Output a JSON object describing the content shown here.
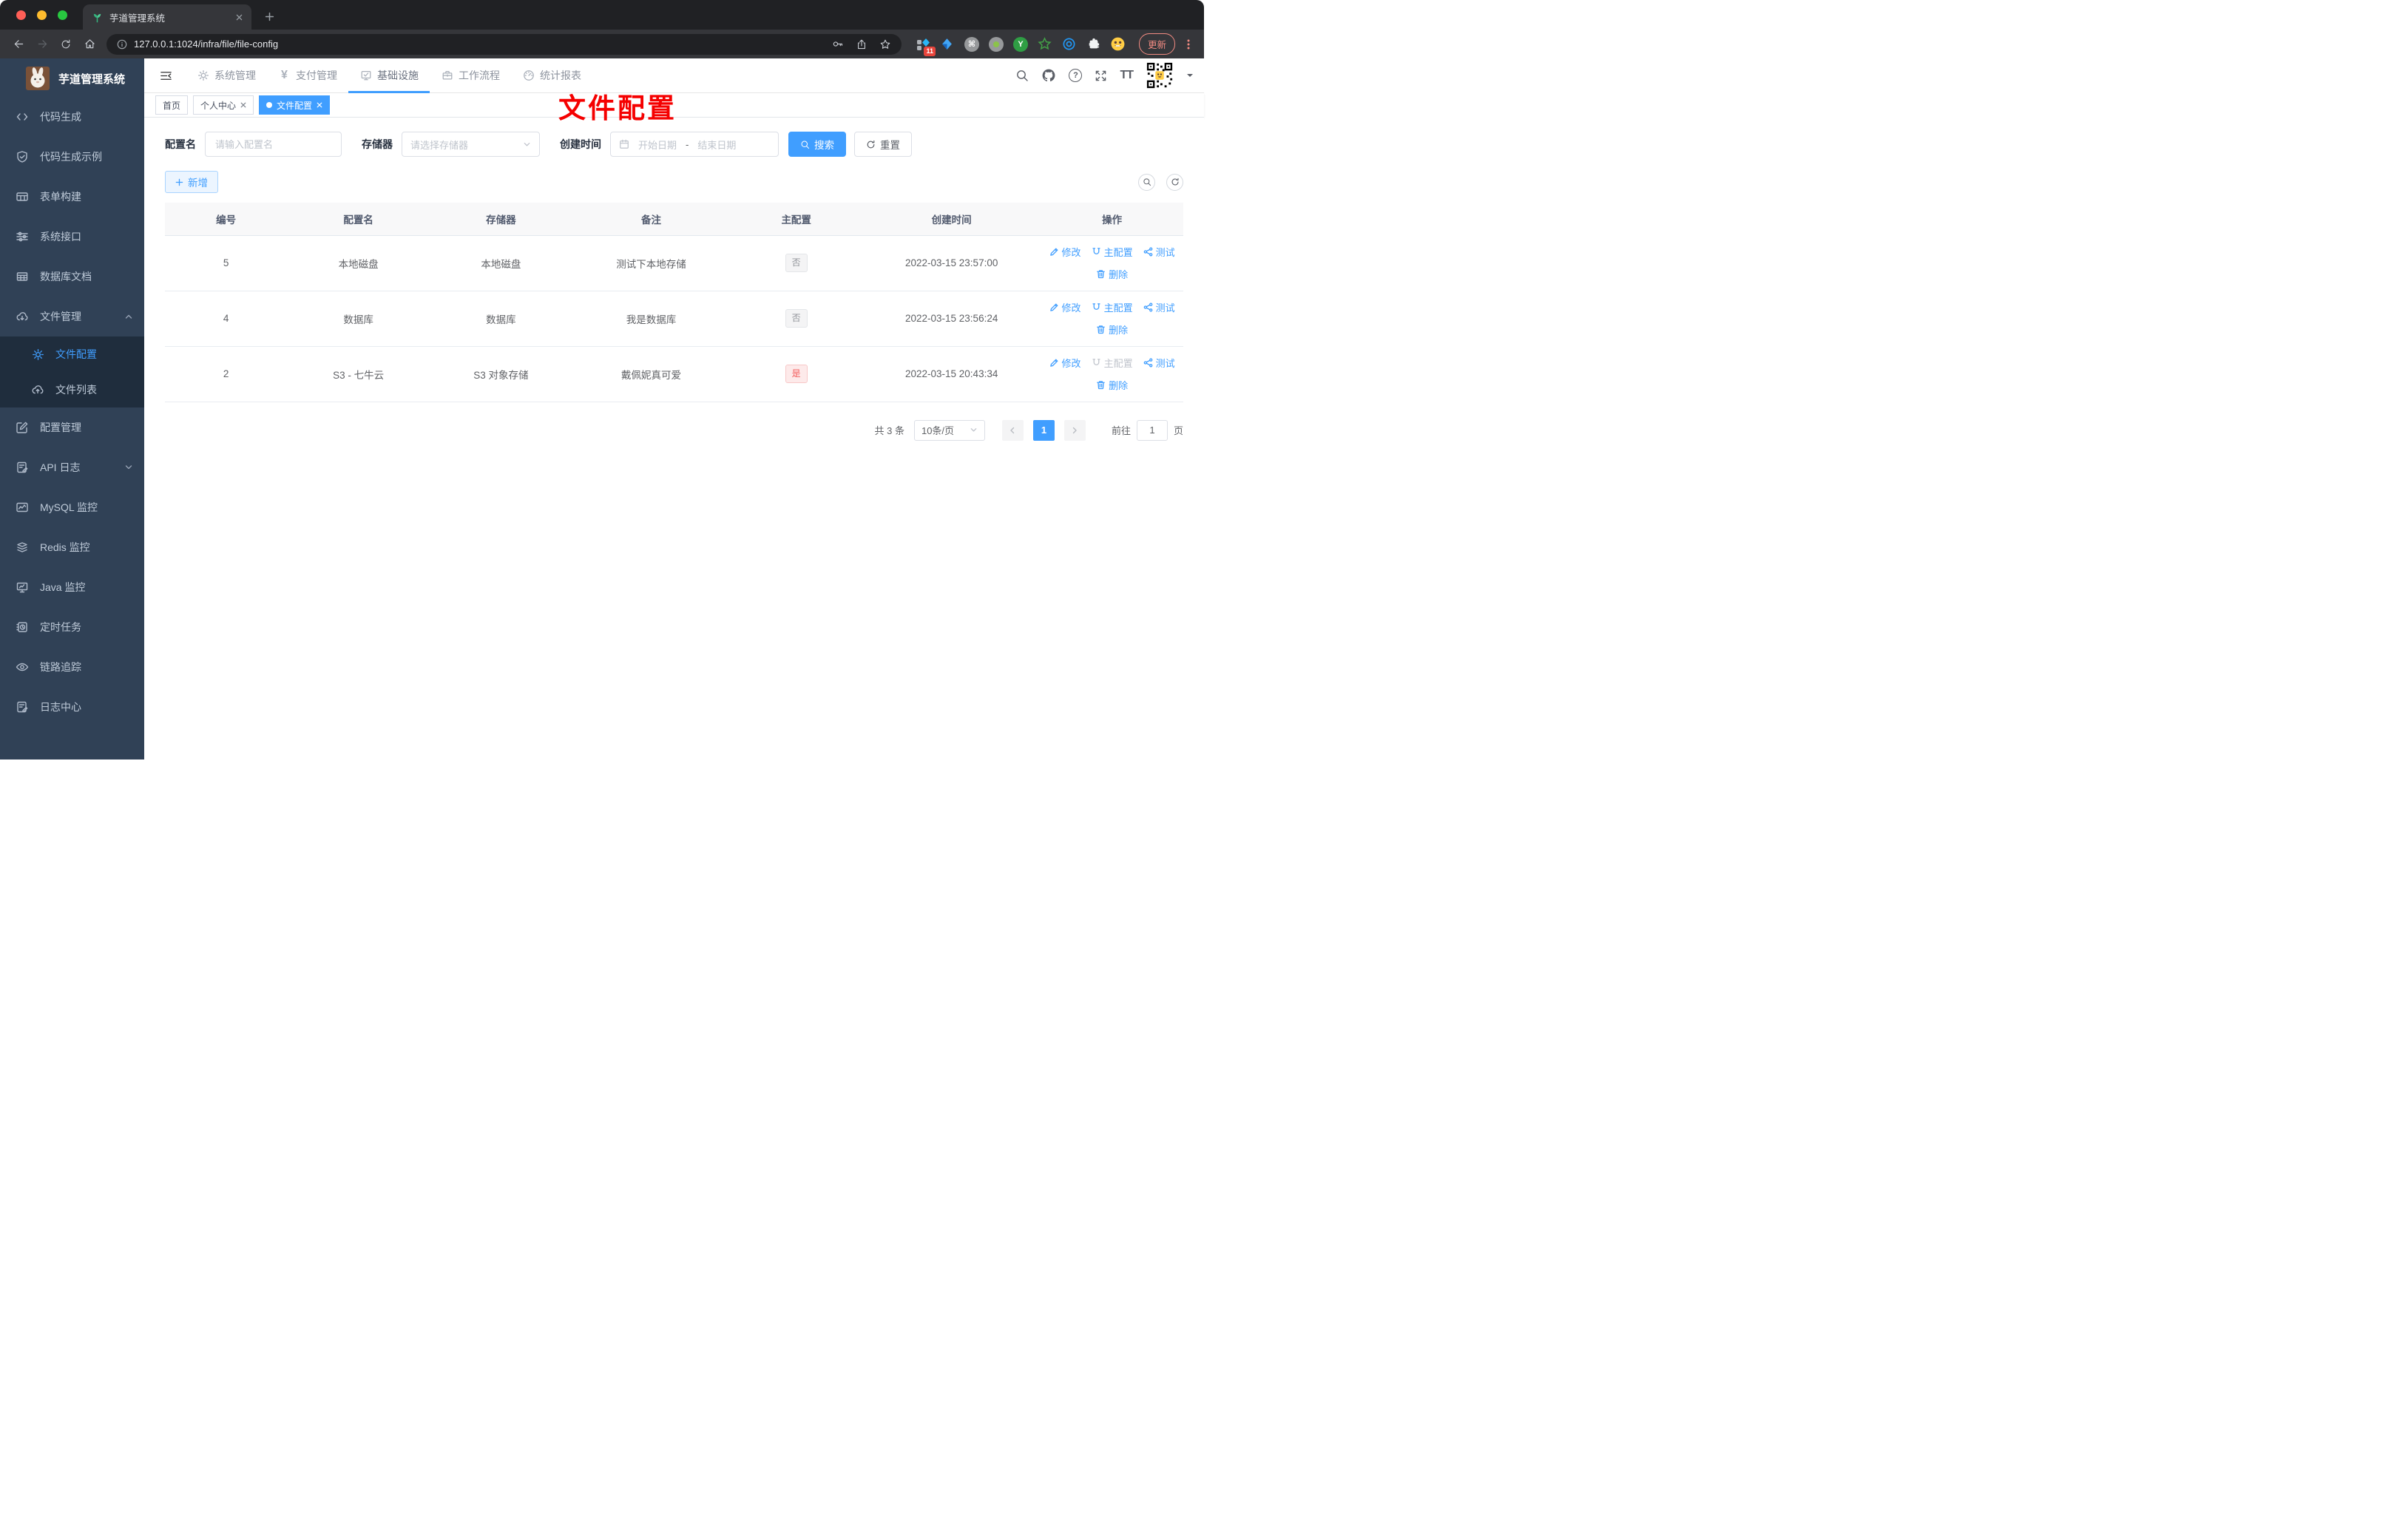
{
  "colors": {
    "primary": "#409eff",
    "sidebar_bg": "#304156",
    "sidebar_submenu_bg": "#1f2d3d",
    "danger_tag_text": "#f56c6c",
    "info_tag_text": "#909399",
    "watermark": "#f50000",
    "browser_update": "#f28b82"
  },
  "icons": {
    "yen": "¥",
    "help": "?",
    "font_size": "TT",
    "command": "⌘",
    "y_badge": "Y",
    "code": "</>"
  },
  "browser": {
    "tab_title": "芋道管理系统",
    "url": "127.0.0.1:1024/infra/file/file-config",
    "extension_badge": "11",
    "update_label": "更新"
  },
  "app": {
    "logo_title": "芋道管理系统",
    "watermark": "文件配置",
    "topnav": [
      {
        "label": "系统管理"
      },
      {
        "label": "支付管理"
      },
      {
        "label": "基础设施",
        "active": true
      },
      {
        "label": "工作流程"
      },
      {
        "label": "统计报表"
      }
    ],
    "tags": [
      {
        "label": "首页"
      },
      {
        "label": "个人中心"
      },
      {
        "label": "文件配置",
        "active": true
      }
    ]
  },
  "sidebar": {
    "items": [
      {
        "label": "代码生成",
        "icon": "code-icon"
      },
      {
        "label": "代码生成示例",
        "icon": "shield-check-icon"
      },
      {
        "label": "表单构建",
        "icon": "form-icon"
      },
      {
        "label": "系统接口",
        "icon": "sliders-icon"
      },
      {
        "label": "数据库文档",
        "icon": "grid-icon"
      },
      {
        "label": "文件管理",
        "icon": "cloud-download-icon",
        "expanded": true,
        "children": [
          {
            "label": "文件配置",
            "icon": "gear-icon",
            "active": true
          },
          {
            "label": "文件列表",
            "icon": "cloud-upload-icon"
          }
        ]
      },
      {
        "label": "配置管理",
        "icon": "edit-square-icon"
      },
      {
        "label": "API 日志",
        "icon": "doc-edit-icon",
        "collapsed": true
      },
      {
        "label": "MySQL 监控",
        "icon": "chart-icon"
      },
      {
        "label": "Redis 监控",
        "icon": "stack-icon"
      },
      {
        "label": "Java 监控",
        "icon": "monitor-icon"
      },
      {
        "label": "定时任务",
        "icon": "schedule-icon"
      },
      {
        "label": "链路追踪",
        "icon": "eye-icon"
      },
      {
        "label": "日志中心",
        "icon": "log-edit-icon"
      }
    ]
  },
  "filters": {
    "name_label": "配置名",
    "name_placeholder": "请输入配置名",
    "storage_label": "存储器",
    "storage_placeholder": "请选择存储器",
    "date_label": "创建时间",
    "date_start": "开始日期",
    "date_separator": "-",
    "date_end": "结束日期",
    "search_label": "搜索",
    "reset_label": "重置"
  },
  "toolbar": {
    "add_label": "新增"
  },
  "table": {
    "columns": [
      "编号",
      "配置名",
      "存储器",
      "备注",
      "主配置",
      "创建时间",
      "操作"
    ],
    "action_labels": {
      "edit": "修改",
      "master": "主配置",
      "test": "测试",
      "delete": "删除"
    },
    "rows": [
      {
        "id": "5",
        "name": "本地磁盘",
        "storage": "本地磁盘",
        "remark": "测试下本地存储",
        "master": "否",
        "master_type": "info",
        "created": "2022-03-15 23:57:00",
        "master_action_disabled": false
      },
      {
        "id": "4",
        "name": "数据库",
        "storage": "数据库",
        "remark": "我是数据库",
        "master": "否",
        "master_type": "info",
        "created": "2022-03-15 23:56:24",
        "master_action_disabled": false
      },
      {
        "id": "2",
        "name": "S3 - 七牛云",
        "storage": "S3 对象存储",
        "remark": "戴佩妮真可爱",
        "master": "是",
        "master_type": "danger",
        "created": "2022-03-15 20:43:34",
        "master_action_disabled": true
      }
    ]
  },
  "pagination": {
    "total": "共 3 条",
    "page_size": "10条/页",
    "current_page": "1",
    "goto_label": "前往",
    "goto_value": "1",
    "page_unit": "页"
  }
}
